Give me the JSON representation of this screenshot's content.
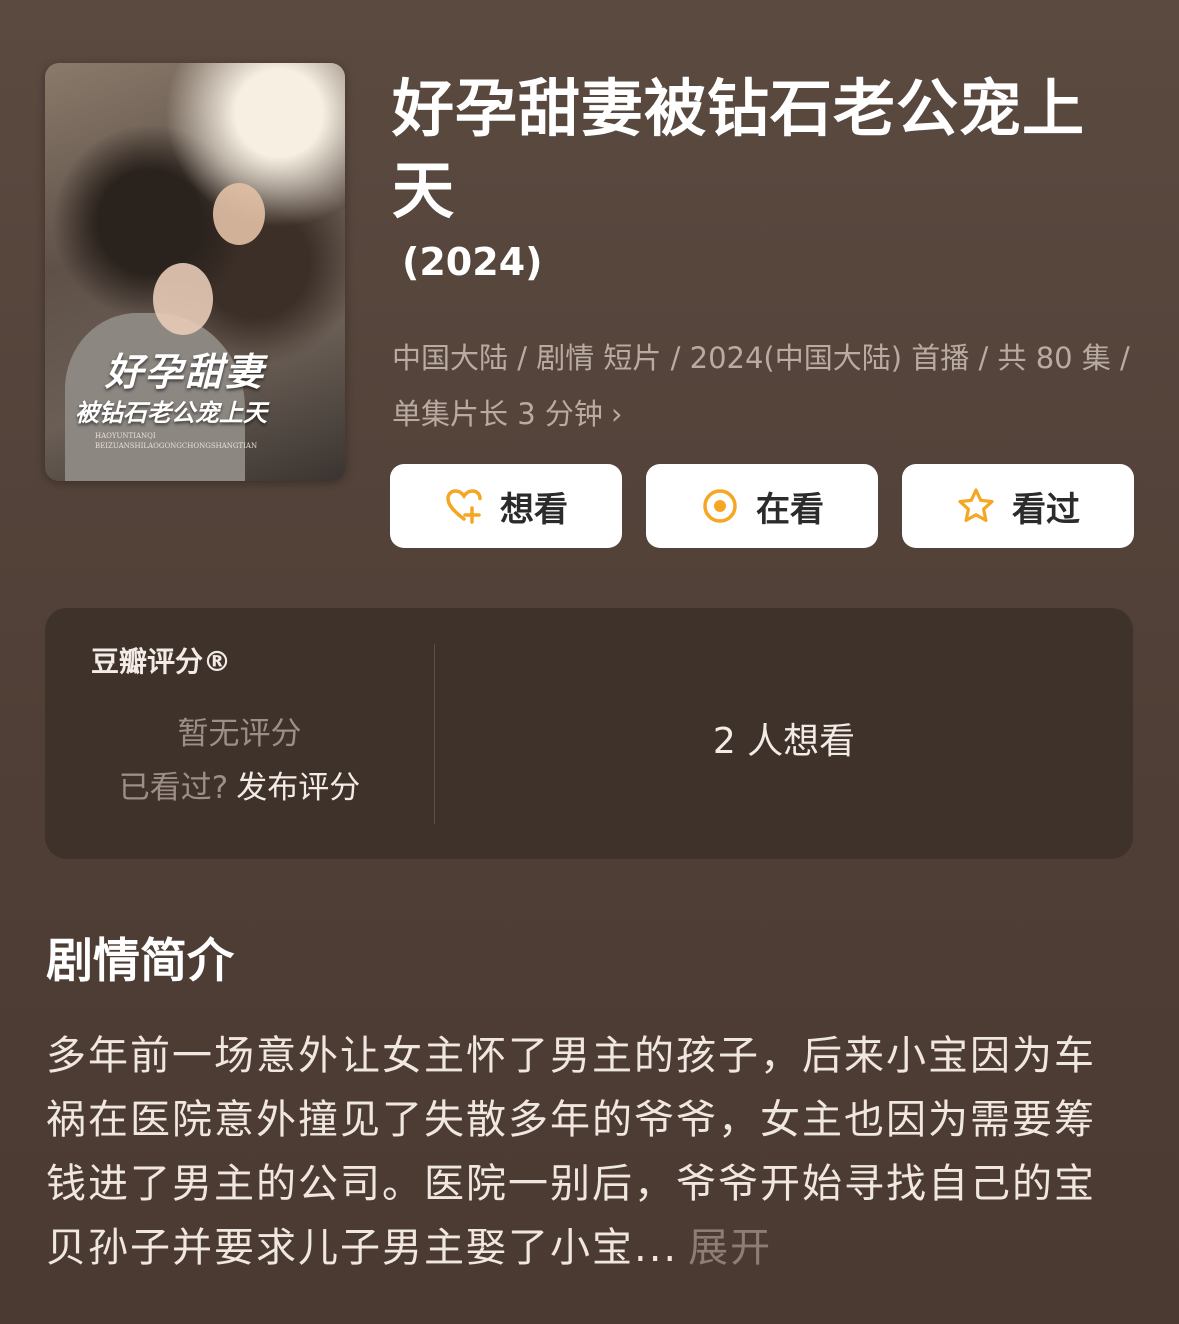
{
  "poster": {
    "title_line1": "好孕甜妻",
    "title_line2": "被钻石老公宠上天",
    "subtitle": "HAOYUNTIANQI BEIZUANSHILAOGONGCHONGSHANGTIAN"
  },
  "title": "好孕甜妻被钻石老公宠上天",
  "year": "(2024)",
  "meta": "中国大陆 / 剧情 短片 / 2024(中国大陆) 首播 / 共 80 集 / 单集片长 3 分钟",
  "actions": {
    "want": "想看",
    "watching": "在看",
    "watched": "看过"
  },
  "colors": {
    "accent": "#f5a623",
    "background": "#5b4a40",
    "card": "#3f322b"
  },
  "rating": {
    "label": "豆瓣评分®",
    "none": "暂无评分",
    "seen_prompt": "已看过?",
    "rate_link": "发布评分",
    "want_count": "2 人想看"
  },
  "synopsis": {
    "heading": "剧情简介",
    "text": "多年前一场意外让女主怀了男主的孩子，后来小宝因为车祸在医院意外撞见了失散多年的爷爷，女主也因为需要筹钱进了男主的公司。医院一别后，爷爷开始寻找自己的宝贝孙子并要求儿子男主娶了小宝...",
    "expand": "展开"
  }
}
